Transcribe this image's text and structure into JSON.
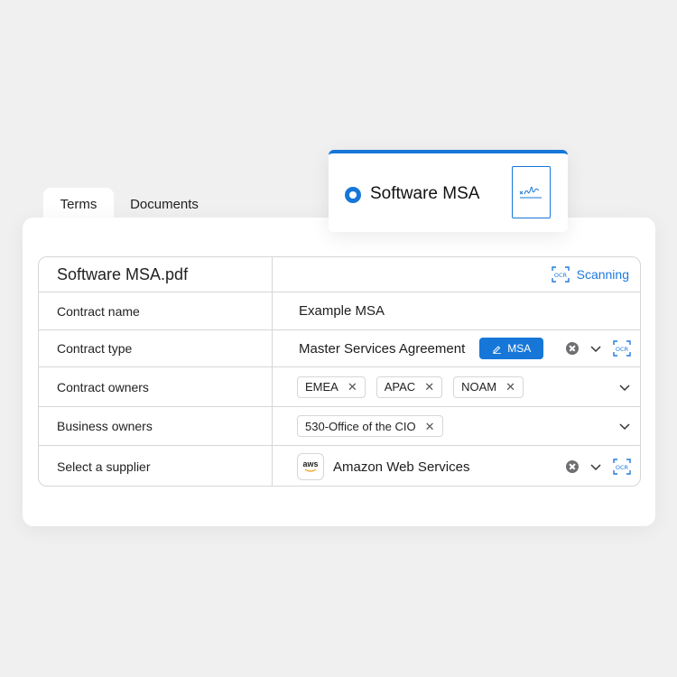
{
  "tabs": [
    {
      "label": "Terms",
      "active": true
    },
    {
      "label": "Documents",
      "active": false
    }
  ],
  "floating_card": {
    "title": "Software MSA",
    "selected": true
  },
  "table": {
    "file_name": "Software MSA.pdf",
    "scan_status": "Scanning",
    "ocr_label": "OCR",
    "rows": {
      "contract_name": {
        "label": "Contract name",
        "value": "Example MSA"
      },
      "contract_type": {
        "label": "Contract type",
        "value": "Master Services Agreement",
        "badge": "MSA"
      },
      "contract_owners": {
        "label": "Contract owners",
        "chips": [
          "EMEA",
          "APAC",
          "NOAM"
        ]
      },
      "business_owners": {
        "label": "Business owners",
        "chips": [
          "530-Office of the CIO"
        ]
      },
      "supplier": {
        "label": "Select a supplier",
        "value": "Amazon Web Services",
        "logo_text": "aws"
      }
    }
  },
  "colors": {
    "accent": "#1677d8",
    "background": "#f0f0f1",
    "border": "#d6d6d8"
  }
}
